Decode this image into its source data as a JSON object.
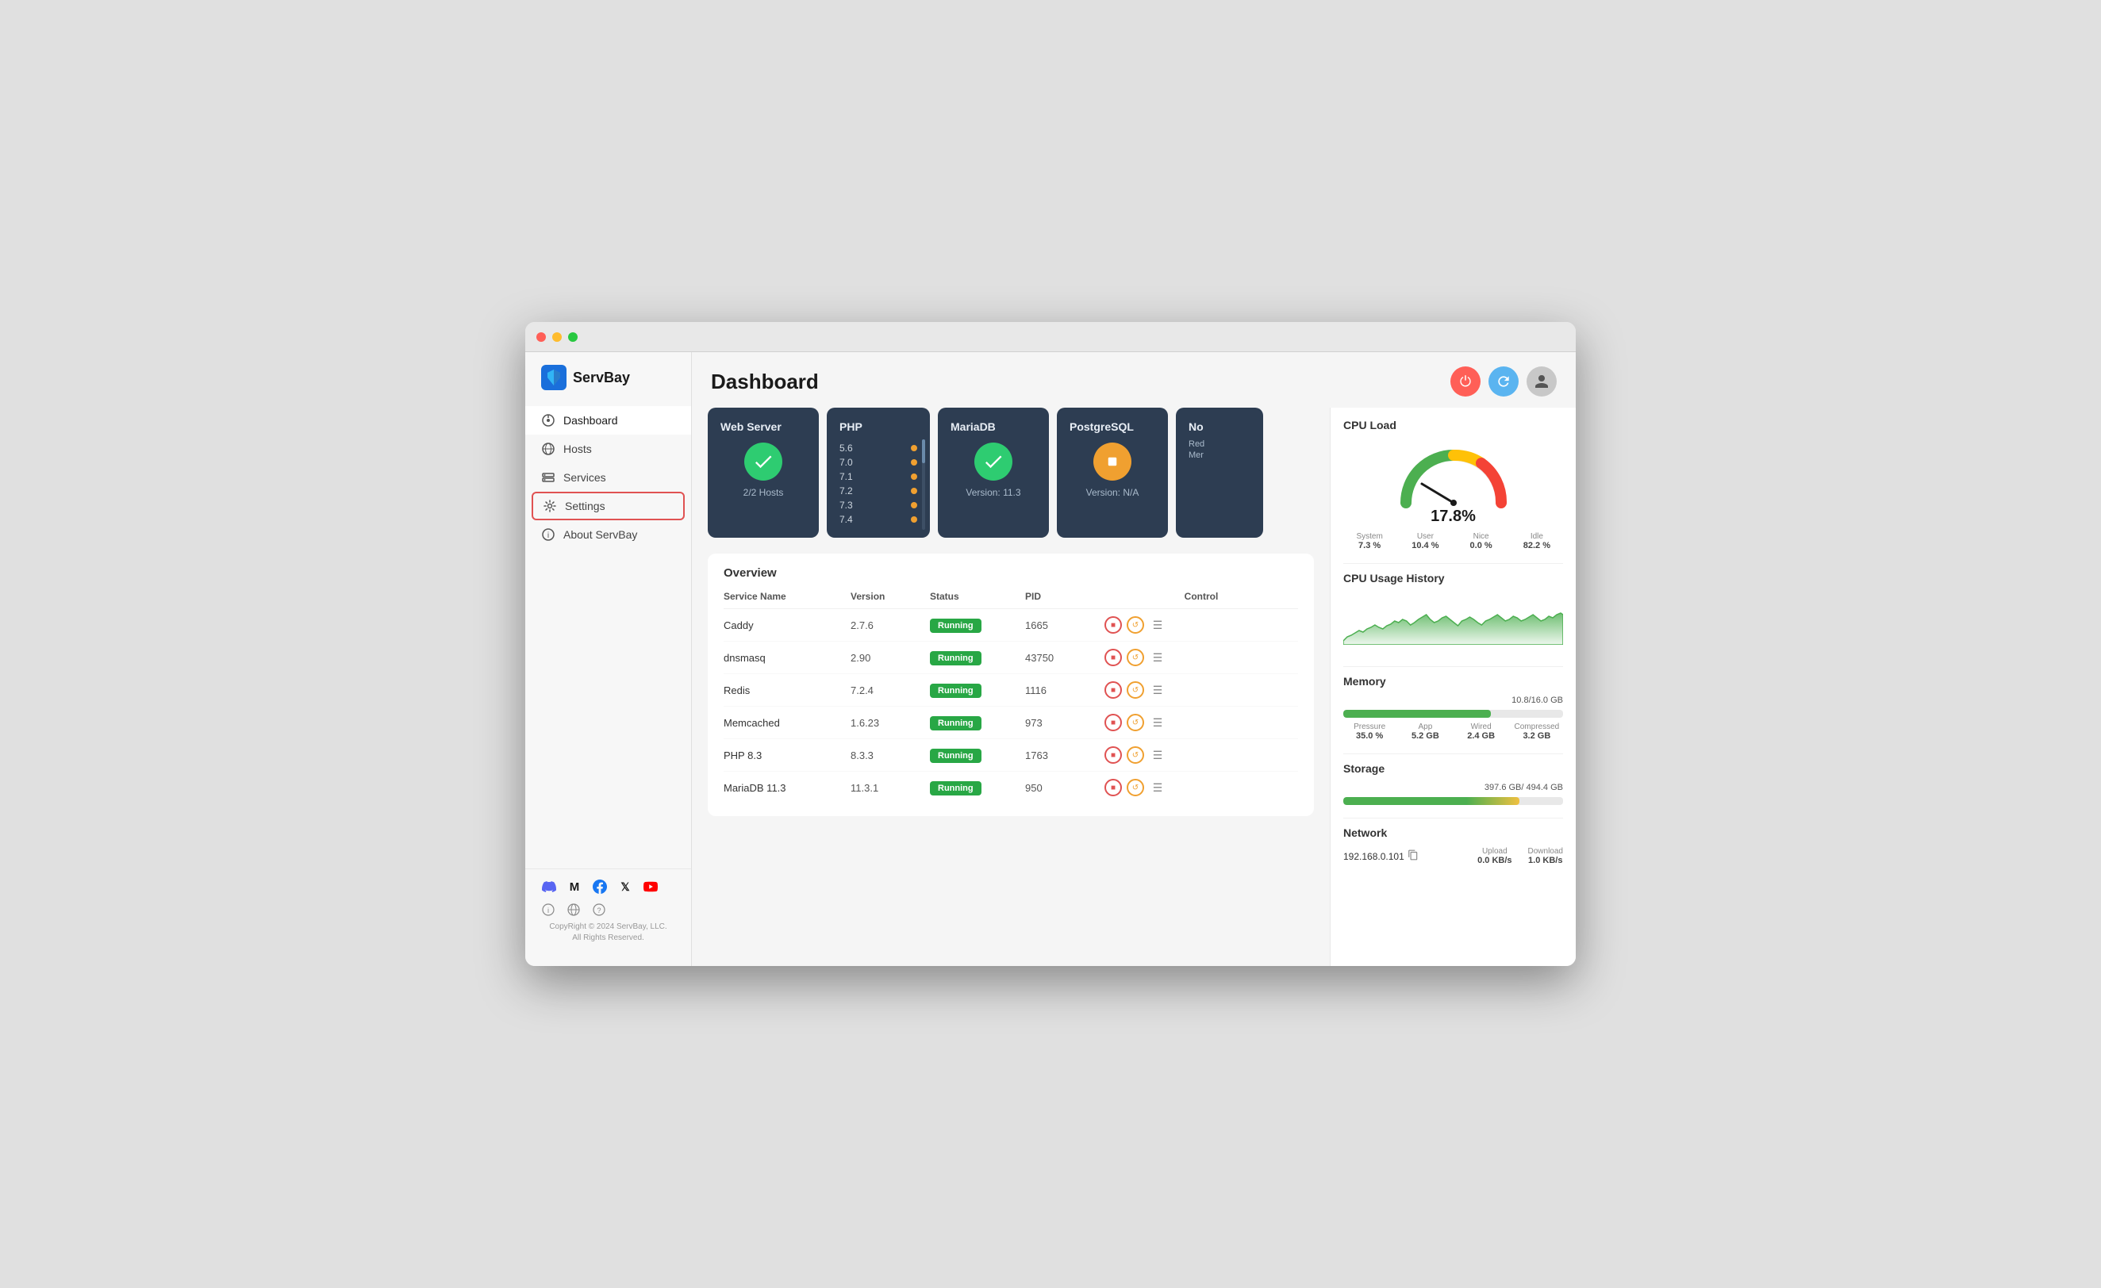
{
  "window": {
    "title": "ServBay Dashboard"
  },
  "titlebar": {
    "dots": [
      "red",
      "yellow",
      "green"
    ]
  },
  "sidebar": {
    "logo": {
      "text": "ServBay"
    },
    "items": [
      {
        "id": "dashboard",
        "label": "Dashboard",
        "icon": "dashboard-icon",
        "active": true,
        "highlighted": false
      },
      {
        "id": "hosts",
        "label": "Hosts",
        "icon": "hosts-icon",
        "active": false,
        "highlighted": false
      },
      {
        "id": "services",
        "label": "Services",
        "icon": "services-icon",
        "active": false,
        "highlighted": false
      },
      {
        "id": "settings",
        "label": "Settings",
        "icon": "settings-icon",
        "active": false,
        "highlighted": true
      },
      {
        "id": "about",
        "label": "About ServBay",
        "icon": "about-icon",
        "active": false,
        "highlighted": false
      }
    ],
    "social": [
      "discord",
      "medium",
      "facebook",
      "x",
      "youtube"
    ],
    "footer_links": [
      "info",
      "globe",
      "help"
    ],
    "copyright": "CopyRight © 2024 ServBay, LLC.\nAll Rights Reserved."
  },
  "header": {
    "title": "Dashboard",
    "actions": {
      "power_label": "⏻",
      "refresh_label": "↻",
      "user_label": "👤"
    }
  },
  "service_cards": [
    {
      "id": "web-server",
      "title": "Web Server",
      "status": "check",
      "status_text": "2/2 Hosts",
      "php_list": null
    },
    {
      "id": "php",
      "title": "PHP",
      "status": "php",
      "php_versions": [
        "5.6",
        "7.0",
        "7.1",
        "7.2",
        "7.3",
        "7.4"
      ],
      "status_text": null
    },
    {
      "id": "mariadb",
      "title": "MariaDB",
      "status": "check",
      "status_text": "Version: 11.3",
      "php_list": null
    },
    {
      "id": "postgresql",
      "title": "PostgreSQL",
      "status": "stop",
      "status_text": "Version: N/A",
      "php_list": null
    },
    {
      "id": "nol-red-mer",
      "title": "No",
      "tags": [
        "Red",
        "Mer"
      ],
      "status": "none"
    }
  ],
  "overview": {
    "title": "Overview",
    "table_headers": [
      "Service Name",
      "Version",
      "Status",
      "PID",
      "Control"
    ],
    "rows": [
      {
        "name": "Caddy",
        "version": "2.7.6",
        "status": "Running",
        "pid": "1665"
      },
      {
        "name": "dnsmasq",
        "version": "2.90",
        "status": "Running",
        "pid": "43750"
      },
      {
        "name": "Redis",
        "version": "7.2.4",
        "status": "Running",
        "pid": "1116"
      },
      {
        "name": "Memcached",
        "version": "1.6.23",
        "status": "Running",
        "pid": "973"
      },
      {
        "name": "PHP 8.3",
        "version": "8.3.3",
        "status": "Running",
        "pid": "1763"
      },
      {
        "name": "MariaDB 11.3",
        "version": "11.3.1",
        "status": "Running",
        "pid": "950"
      }
    ]
  },
  "right_panel": {
    "cpu_load": {
      "title": "CPU Load",
      "value": "17.8%",
      "system": "7.3 %",
      "user": "10.4 %",
      "nice": "0.0 %",
      "idle": "82.2 %"
    },
    "cpu_history": {
      "title": "CPU Usage History"
    },
    "memory": {
      "title": "Memory",
      "used": "10.8",
      "total": "16.0",
      "unit": "GB",
      "fill_percent": 67,
      "pressure": "35.0 %",
      "app": "5.2 GB",
      "wired": "2.4 GB",
      "compressed": "3.2 GB"
    },
    "storage": {
      "title": "Storage",
      "used": "397.6 GB",
      "total": "494.4 GB"
    },
    "network": {
      "title": "Network",
      "ip": "192.168.0.101",
      "upload_label": "Upload",
      "upload_value": "0.0 KB/s",
      "download_label": "Download",
      "download_value": "1.0 KB/s"
    }
  }
}
